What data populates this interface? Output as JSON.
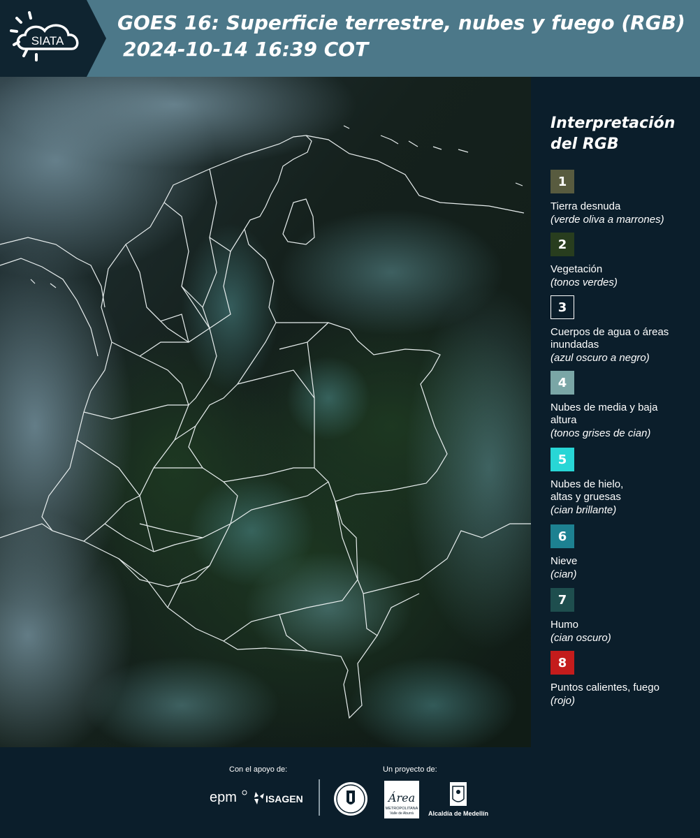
{
  "header": {
    "logo_text": "SIATA",
    "title_line1": "GOES 16: Superficie terrestre, nubes y fuego (RGB)",
    "title_line2": "2024-10-14 16:39 COT"
  },
  "legend": {
    "title": "Interpretación del RGB",
    "items": [
      {
        "number": "1",
        "color": "#585b3f",
        "label": "Tierra desnuda",
        "desc": "(verde oliva a marrones)"
      },
      {
        "number": "2",
        "color": "#283d1e",
        "label": "Vegetación",
        "desc": "(tonos verdes)"
      },
      {
        "number": "3",
        "color": "#0b1e2b",
        "label": "Cuerpos de agua o áreas inundadas",
        "desc": "(azul oscuro a negro)"
      },
      {
        "number": "4",
        "color": "#7aa6a6",
        "label": "Nubes de media y baja altura",
        "desc": "(tonos grises de cian)"
      },
      {
        "number": "5",
        "color": "#28d6d6",
        "label": "Nubes de hielo, altas y gruesas",
        "desc": "(cian brillante)"
      },
      {
        "number": "6",
        "color": "#1d8191",
        "label": "Nieve",
        "desc": "(cian)"
      },
      {
        "number": "7",
        "color": "#1e4e4e",
        "label": "Humo",
        "desc": "(cian oscuro)"
      },
      {
        "number": "8",
        "color": "#c41c1c",
        "label": "Puntos calientes, fuego",
        "desc": "(rojo)"
      }
    ]
  },
  "footer": {
    "support_caption": "Con el apoyo de:",
    "project_caption": "Un proyecto de:",
    "epm_text": "epm",
    "isagen_text": "ISAGEN",
    "area_text": "Área",
    "area_sub": "METROPOLITANA",
    "area_sub2": "Valle de Aburrá",
    "alcaldia_text": "Alcaldía de Medellín"
  },
  "colors": {
    "header_bg": "#4c7889",
    "logo_panel_bg": "#0f2430",
    "page_bg": "#0b1e2b"
  }
}
